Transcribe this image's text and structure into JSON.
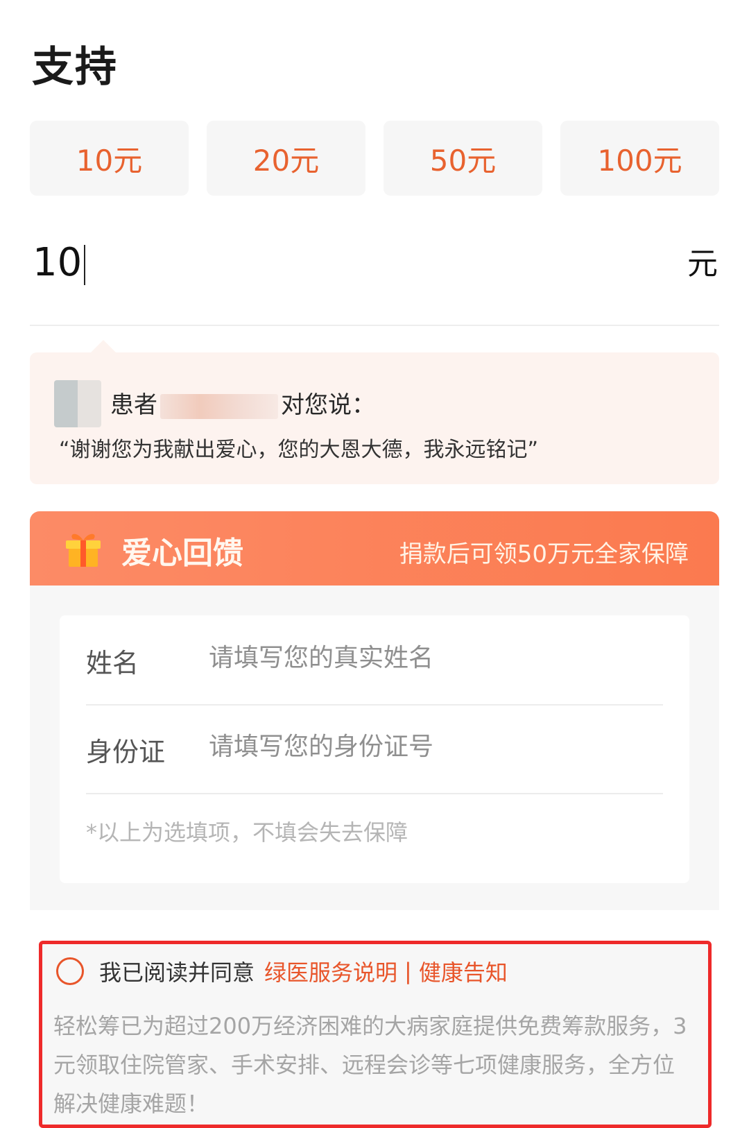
{
  "page": {
    "title": "支持"
  },
  "amount_options": [
    "10元",
    "20元",
    "50元",
    "100元"
  ],
  "amount_input": {
    "value": "10",
    "unit": "元"
  },
  "message": {
    "prefix": "患者",
    "suffix": "对您说：",
    "quote": "“谢谢您为我献出爱心，您的大恩大德，我永远铭记”"
  },
  "reward": {
    "title": "爱心回馈",
    "subtitle": "捐款后可领50万元全家保障",
    "form": {
      "name_label": "姓名",
      "name_placeholder": "请填写您的真实姓名",
      "id_label": "身份证",
      "id_placeholder": "请填写您的身份证号",
      "note": "*以上为选填项，不填会失去保障"
    }
  },
  "agreement": {
    "text": "我已阅读并同意",
    "link1": "绿医服务说明",
    "separator": "|",
    "link2": "健康告知",
    "description": "轻松筹已为超过200万经济困难的大病家庭提供免费筹款服务，3元领取住院管家、手术安排、远程会诊等七项健康服务，全方位解决健康难题！"
  },
  "colors": {
    "accent": "#e8622f",
    "reward_header": "#fb7a4f",
    "highlight_border": "#ee2a2a"
  }
}
